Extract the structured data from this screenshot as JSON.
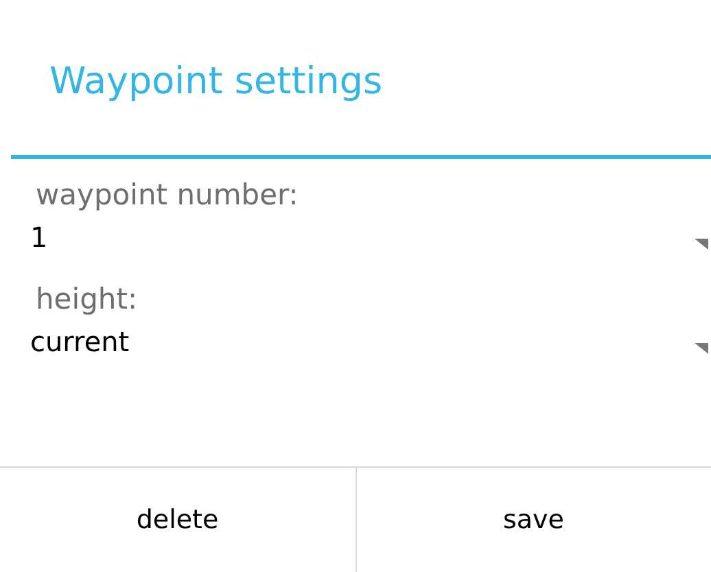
{
  "dialog": {
    "title": "Waypoint settings"
  },
  "fields": [
    {
      "label": "waypoint number:",
      "value": "1"
    },
    {
      "label": "height:",
      "value": "current"
    }
  ],
  "buttons": [
    {
      "label": "delete"
    },
    {
      "label": "save"
    }
  ]
}
